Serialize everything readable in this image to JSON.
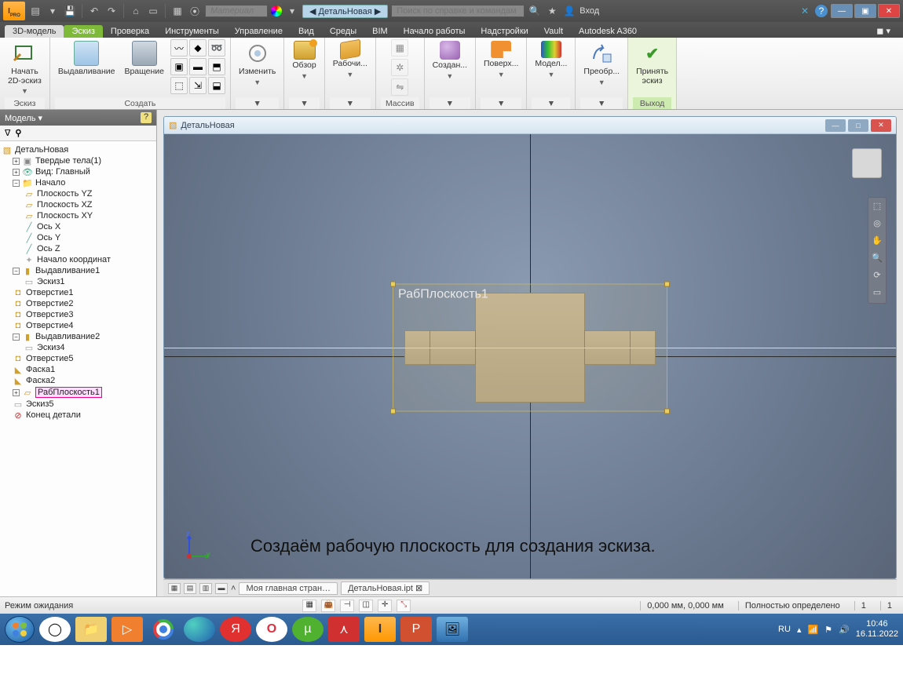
{
  "qat": {
    "logo_text": "I",
    "material_placeholder": "Материал",
    "doc_tab": "ДетальНовая",
    "search_placeholder": "Поиск по справке и командам",
    "signin": "Вход"
  },
  "tabs": {
    "model3d": "3D-модель",
    "sketch": "Эскиз",
    "inspect": "Проверка",
    "tools": "Инструменты",
    "manage": "Управление",
    "view": "Вид",
    "environments": "Среды",
    "bim": "BIM",
    "getstarted": "Начало работы",
    "addins": "Надстройки",
    "vault": "Vault",
    "a360": "Autodesk A360"
  },
  "ribbon": {
    "sketch": {
      "start": "Начать\n2D-эскиз",
      "panel": "Эскиз"
    },
    "create": {
      "extrude": "Выдавливание",
      "revolve": "Вращение",
      "panel": "Создать"
    },
    "modify": {
      "label": "Изменить"
    },
    "browse": {
      "label": "Обзор"
    },
    "workfeat": {
      "label": "Рабочи..."
    },
    "pattern": {
      "panel": "Массив"
    },
    "freeform": {
      "label": "Создан..."
    },
    "surface": {
      "label": "Поверх..."
    },
    "simulate": {
      "label": "Модел..."
    },
    "convert": {
      "label": "Преобр..."
    },
    "finish": {
      "label": "Принять\nэскиз",
      "panel": "Выход"
    }
  },
  "browser": {
    "title": "Модель ▾",
    "root": "ДетальНовая",
    "solids": "Твердые тела(1)",
    "view": "Вид: Главный",
    "origin": "Начало",
    "planeYZ": "Плоскость YZ",
    "planeXZ": "Плоскость XZ",
    "planeXY": "Плоскость XY",
    "axisX": "Ось X",
    "axisY": "Ось Y",
    "axisZ": "Ось Z",
    "origin_pt": "Начало координат",
    "extrude1": "Выдавливание1",
    "sketch1": "Эскиз1",
    "hole1": "Отверстие1",
    "hole2": "Отверстие2",
    "hole3": "Отверстие3",
    "hole4": "Отверстие4",
    "extrude2": "Выдавливание2",
    "sketch4": "Эскиз4",
    "hole5": "Отверстие5",
    "chamfer1": "Фаска1",
    "chamfer2": "Фаска2",
    "workplane1": "РабПлоскость1",
    "sketch5": "Эскиз5",
    "end": "Конец детали"
  },
  "viewport": {
    "doc_title": "ДетальНовая",
    "workplane_label": "РабПлоскость1",
    "caption": "Создаём рабочую плоскость для создания эскиза.",
    "axis_z": "z",
    "axis_y": "y"
  },
  "doctabs": {
    "home": "Моя главная стран…",
    "active": "ДетальНовая.ipt"
  },
  "status": {
    "mode": "Режим ожидания",
    "coords": "0,000 мм, 0,000 мм",
    "constraint": "Полностью определено",
    "n1": "1",
    "n2": "1"
  },
  "taskbar": {
    "lang": "RU",
    "time": "10:46",
    "date": "16.11.2022"
  }
}
